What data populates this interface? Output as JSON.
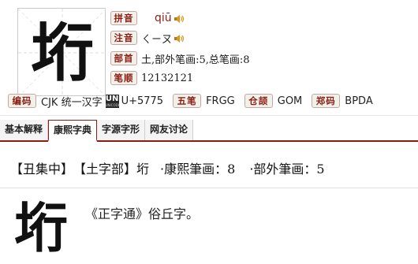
{
  "character": "垳",
  "pinyin": {
    "label": "拼音",
    "value": "qiū"
  },
  "zhuyin": {
    "label": "注音",
    "value": "ㄑㄧㄡ"
  },
  "radical": {
    "label": "部首",
    "value": "土,部外笔画:5,总笔画:8"
  },
  "stroke_order": {
    "label": "笔顺",
    "value": "12132121"
  },
  "codes": {
    "bianma_label": "编码",
    "bianma_value": "CJK 统一汉字",
    "unicode_badge": "UN",
    "unicode_badge_sub": "UNICODE",
    "unicode_value": "U+5775",
    "wubi_label": "五笔",
    "wubi_value": "FRGG",
    "cangjie_label": "仓颉",
    "cangjie_value": "GOM",
    "zhengma_label": "郑码",
    "zhengma_value": "BPDA"
  },
  "tabs": [
    "基本解释",
    "康熙字典",
    "字源字形",
    "网友讨论"
  ],
  "active_tab": "康熙字典",
  "kangxi": {
    "ji": "【丑集中】",
    "bu": "【土字部】",
    "char": "垳",
    "kangxi_strokes": "·康熙筆画：8",
    "outside_strokes": "·部外筆画：5"
  },
  "entry": {
    "char": "垳",
    "text": "《正字通》俗丘字。"
  }
}
